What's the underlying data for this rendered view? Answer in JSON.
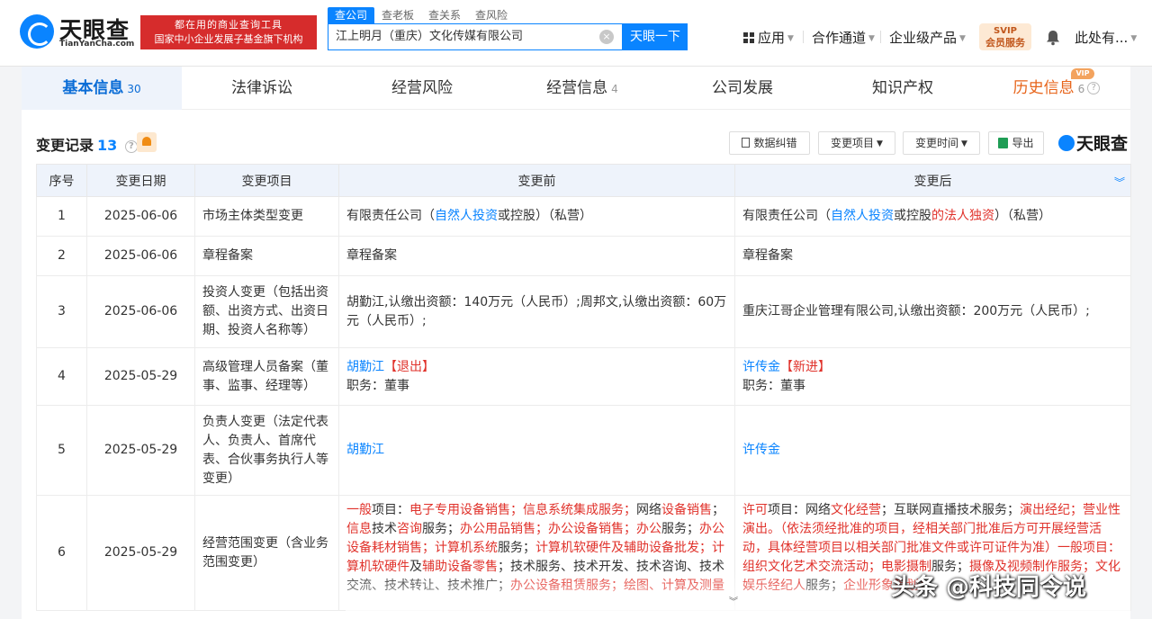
{
  "header": {
    "logo_text": "天眼查",
    "logo_sub": "TianYanCha.com",
    "banner_line1": "都在用的商业查询工具",
    "banner_line2": "国家中小企业发展子基金旗下机构",
    "search_tabs": [
      "查公司",
      "查老板",
      "查关系",
      "查风险"
    ],
    "search_value": "江上明月（重庆）文化传媒有限公司",
    "search_button": "天眼一下",
    "nav": [
      "应用",
      "合作通道",
      "企业级产品"
    ],
    "svip_line1": "SVIP",
    "svip_line2": "会员服务",
    "user": "此处有..."
  },
  "tabs": [
    {
      "label": "基本信息",
      "count": "30"
    },
    {
      "label": "法律诉讼",
      "count": ""
    },
    {
      "label": "经营风险",
      "count": ""
    },
    {
      "label": "经营信息",
      "count": "4"
    },
    {
      "label": "公司发展",
      "count": ""
    },
    {
      "label": "知识产权",
      "count": ""
    },
    {
      "label": "历史信息",
      "count": "6"
    }
  ],
  "vip_badge": "VIP",
  "section": {
    "title": "变更记录",
    "count": "13",
    "btn_correct": "数据纠错",
    "btn_item": "变更项目",
    "btn_time": "变更时间",
    "btn_export": "导出",
    "brand": "天眼查"
  },
  "table": {
    "headers": [
      "序号",
      "变更日期",
      "变更项目",
      "变更前",
      "变更后"
    ],
    "rows": [
      {
        "no": "1",
        "date": "2025-06-06",
        "item": "市场主体类型变更"
      },
      {
        "no": "2",
        "date": "2025-06-06",
        "item": "章程备案",
        "before": "章程备案",
        "after": "章程备案"
      },
      {
        "no": "3",
        "date": "2025-06-06",
        "item": "投资人变更（包括出资额、出资方式、出资日期、投资人名称等）",
        "before": "胡勤江,认缴出资额：140万元（人民币）;周邦文,认缴出资额：60万元（人民币）;",
        "after": "重庆江哥企业管理有限公司,认缴出资额：200万元（人民币）;"
      },
      {
        "no": "4",
        "date": "2025-05-29",
        "item": "高级管理人员备案（董事、监事、经理等）"
      },
      {
        "no": "5",
        "date": "2025-05-29",
        "item": "负责人变更（法定代表人、负责人、首席代表、合伙事务执行人等变更）",
        "before": "胡勤江",
        "after": "许传金"
      },
      {
        "no": "6",
        "date": "2025-05-29",
        "item": "经营范围变更（含业务范围变更）"
      }
    ],
    "r1_before": {
      "a": "有限责任公司（",
      "b": "自然人投资",
      "c": "或控股）（私营）"
    },
    "r1_after": {
      "a": "有限责任公司（",
      "b": "自然人投资",
      "c": "或控股",
      "d": "的法人独资",
      "e": "）（私营）"
    },
    "r4_before": {
      "name": "胡勤江",
      "tag": "【退出】",
      "role": "职务：董事"
    },
    "r4_after": {
      "name": "许传金",
      "tag": "【新进】",
      "role": "职务：董事"
    },
    "r6_before": [
      {
        "t": "一般",
        "red": true
      },
      {
        "t": "项目：",
        "red": false
      },
      {
        "t": "电子专用设备销售；信息系统集成服务；",
        "red": true
      },
      {
        "t": "网络",
        "red": false
      },
      {
        "t": "设备销售",
        "red": true
      },
      {
        "t": "；",
        "red": false
      },
      {
        "t": "信息",
        "red": true
      },
      {
        "t": "技术",
        "red": false
      },
      {
        "t": "咨询",
        "red": true
      },
      {
        "t": "服务；",
        "red": false
      },
      {
        "t": "办公用品销售；办公设备销售；办公",
        "red": true
      },
      {
        "t": "服务；",
        "red": false
      },
      {
        "t": "办公设备耗材销售；计算机系统",
        "red": true
      },
      {
        "t": "服务；",
        "red": false
      },
      {
        "t": "计算机软硬件及辅助设备批发；计算机软硬件",
        "red": true
      },
      {
        "t": "及",
        "red": false
      },
      {
        "t": "辅助设备零售",
        "red": true
      },
      {
        "t": "；技术服务、技术开发、技术咨询、技术交流、技术转让、技术推广；",
        "red": false
      },
      {
        "t": "办公设备租赁服务；绘图、计算及测量",
        "red": true
      }
    ],
    "r6_after": [
      {
        "t": "许可",
        "red": true
      },
      {
        "t": "项目：网络",
        "red": false
      },
      {
        "t": "文化经营",
        "red": true
      },
      {
        "t": "；互联网直播技术服务；",
        "red": false
      },
      {
        "t": "演出经纪；营业性演出。（依法须经批准的项目，经相关部门批准后方可开展经营活动，具体经营项目以相关部门批准文件或许可证件为准）一般项目：组织文化艺术交流活动；电影摄制",
        "red": true
      },
      {
        "t": "服务；",
        "red": false
      },
      {
        "t": "摄像及视频制作服务；文化娱乐经纪人",
        "red": true
      },
      {
        "t": "服务；",
        "red": false
      },
      {
        "t": "企业形象策划；",
        "red": true
      }
    ]
  },
  "watermark": "头条 @科技同令说"
}
